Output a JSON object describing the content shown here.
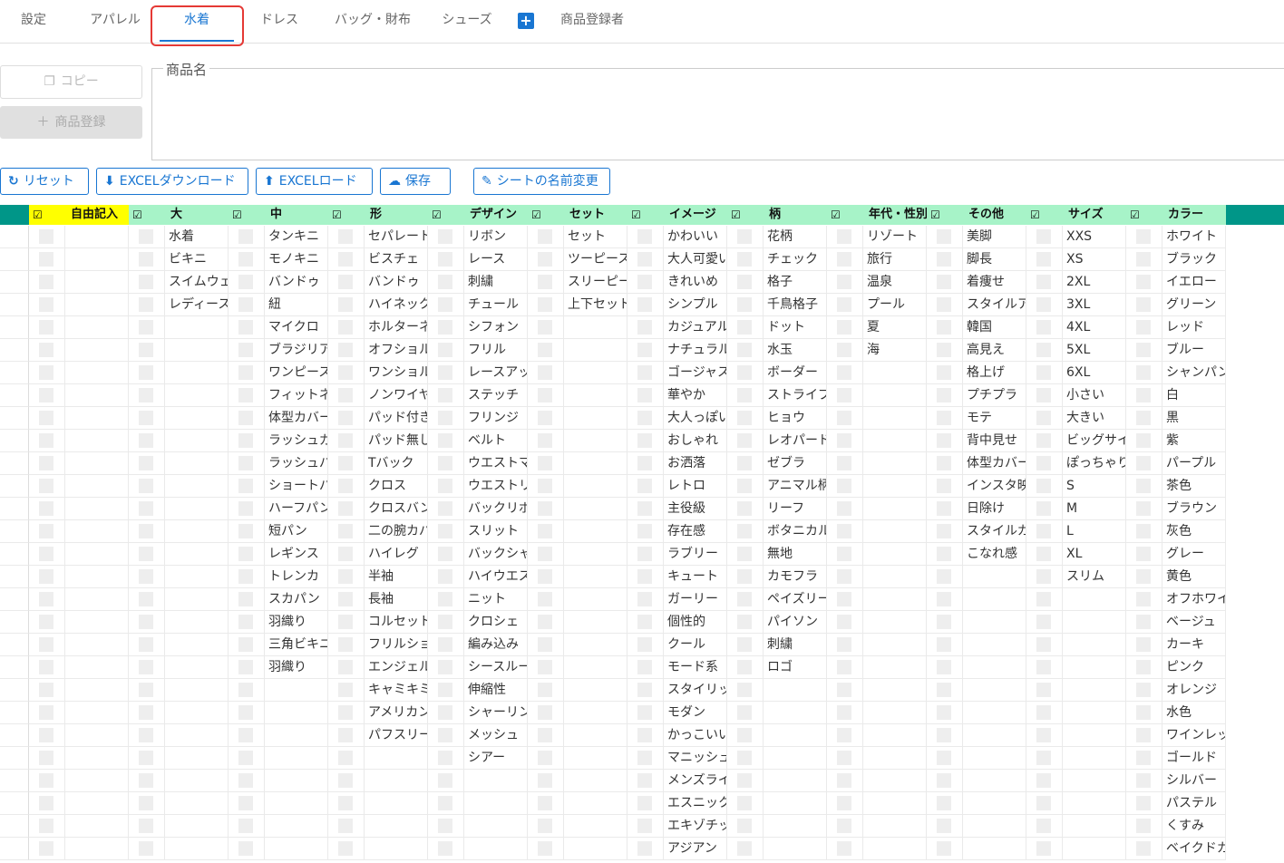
{
  "tabs": [
    {
      "label": "設定"
    },
    {
      "label": "アパレル"
    },
    {
      "label": "水着"
    },
    {
      "label": "ドレス"
    },
    {
      "label": "バッグ・財布"
    },
    {
      "label": "シューズ"
    },
    {
      "label": "商品登録者"
    }
  ],
  "active_tab": "水着",
  "sidebar": {
    "copy_label": "コピー",
    "register_label": "商品登録"
  },
  "product_name": {
    "label": "商品名",
    "value": ""
  },
  "toolbar": {
    "reset_label": "リセット",
    "download_label": "EXCELダウンロード",
    "upload_label": "EXCELロード",
    "save_label": "保存",
    "rename_label": "シートの名前変更"
  },
  "grid": {
    "check_symbol": "☑",
    "columns": [
      {
        "header": "自由記入",
        "header_color": "#ffff00",
        "values": []
      },
      {
        "header": "大",
        "header_color": "#a7f3c8",
        "values": [
          "水着",
          "ビキニ",
          "スイムウェ",
          "レディース"
        ]
      },
      {
        "header": "中",
        "header_color": "#a7f3c8",
        "values": [
          "タンキニ",
          "モノキニ",
          "バンドゥ",
          "紐",
          "マイクロ",
          "ブラジリア",
          "ワンピース",
          "フィットネ",
          "体型カバー",
          "ラッシュガ",
          "ラッシュパ",
          "ショートパ",
          "ハーフパン",
          "短パン",
          "レギンス",
          "トレンカ",
          "スカパン",
          "羽織り",
          "三角ビキニ",
          "羽織り"
        ]
      },
      {
        "header": "形",
        "header_color": "#a7f3c8",
        "values": [
          "セパレート",
          "ビスチェ",
          "バンドゥ",
          "ハイネック",
          "ホルターネ",
          "オフショル",
          "ワンショル",
          "ノンワイヤ",
          "パッド付き",
          "パッド無し",
          "Tバック",
          "クロス",
          "クロスバン",
          "二の腕カバ",
          "ハイレグ",
          "半袖",
          "長袖",
          "コルセット",
          "フリルショ",
          "エンジェル",
          "キャミキミ",
          "アメリカン",
          "パフスリー"
        ]
      },
      {
        "header": "デザイン",
        "header_color": "#a7f3c8",
        "values": [
          "リボン",
          "レース",
          "刺繍",
          "チュール",
          "シフォン",
          "フリル",
          "レースアッ",
          "ステッチ",
          "フリンジ",
          "ベルト",
          "ウエストマ",
          "ウエストリ",
          "バックリボ",
          "スリット",
          "バックシャ",
          "ハイウエス",
          "ニット",
          "クロシェ",
          "編み込み",
          "シースルー",
          "伸縮性",
          "シャーリン",
          "メッシュ",
          "シアー"
        ]
      },
      {
        "header": "セット",
        "header_color": "#a7f3c8",
        "values": [
          "セット",
          "ツーピース",
          "スリーピー",
          "上下セット"
        ]
      },
      {
        "header": "イメージ",
        "header_color": "#a7f3c8",
        "values": [
          "かわいい",
          "大人可愛い",
          "きれいめ",
          "シンプル",
          "カジュアル",
          "ナチュラル",
          "ゴージャス",
          "華やか",
          "大人っぽい",
          "おしゃれ",
          "お洒落",
          "レトロ",
          "主役級",
          "存在感",
          "ラブリー",
          "キュート",
          "ガーリー",
          "個性的",
          "クール",
          "モード系",
          "スタイリッ",
          "モダン",
          "かっこいい",
          "マニッシュ",
          "メンズライ",
          "エスニック",
          "エキゾチッ",
          "アジアン"
        ]
      },
      {
        "header": "柄",
        "header_color": "#a7f3c8",
        "values": [
          "花柄",
          "チェック",
          "格子",
          "千鳥格子",
          "ドット",
          "水玉",
          "ボーダー",
          "ストライプ",
          "ヒョウ",
          "レオパード",
          "ゼブラ",
          "アニマル柄",
          "リーフ",
          "ボタニカル",
          "無地",
          "カモフラ",
          "ペイズリー",
          "パイソン",
          "刺繍",
          "ロゴ"
        ]
      },
      {
        "header": "年代・性別",
        "header_color": "#a7f3c8",
        "values": [
          "リゾート",
          "旅行",
          "温泉",
          "プール",
          "夏",
          "海"
        ]
      },
      {
        "header": "その他",
        "header_color": "#a7f3c8",
        "values": [
          "美脚",
          "脚長",
          "着痩せ",
          "スタイルア",
          "韓国",
          "高見え",
          "格上げ",
          "プチプラ",
          "モテ",
          "背中見せ",
          "体型カバー",
          "インスタ映",
          "日除け",
          "スタイルカ",
          "こなれ感"
        ]
      },
      {
        "header": "サイズ",
        "header_color": "#a7f3c8",
        "values": [
          "XXS",
          "XS",
          "2XL",
          "3XL",
          "4XL",
          "5XL",
          "6XL",
          "小さい",
          "大きい",
          "ビッグサイ",
          "ぽっちゃり",
          "S",
          "M",
          "L",
          "XL",
          "スリム"
        ]
      },
      {
        "header": "カラー",
        "header_color": "#a7f3c8",
        "values": [
          "ホワイト",
          "ブラック",
          "イエロー",
          "グリーン",
          "レッド",
          "ブルー",
          "シャンパン",
          "白",
          "黒",
          "紫",
          "パープル",
          "茶色",
          "ブラウン",
          "灰色",
          "グレー",
          "黄色",
          "オフホワイ",
          "ベージュ",
          "カーキ",
          "ピンク",
          "オレンジ",
          "水色",
          "ワインレッ",
          "ゴールド",
          "シルバー",
          "パステル",
          "くすみ",
          "ベイクドカ"
        ]
      }
    ]
  },
  "colors": {
    "accent": "#1976d2",
    "header_teal": "#009688",
    "header_green": "#a7f3c8",
    "header_yellow": "#ffff00",
    "highlight_red": "#e53935"
  }
}
